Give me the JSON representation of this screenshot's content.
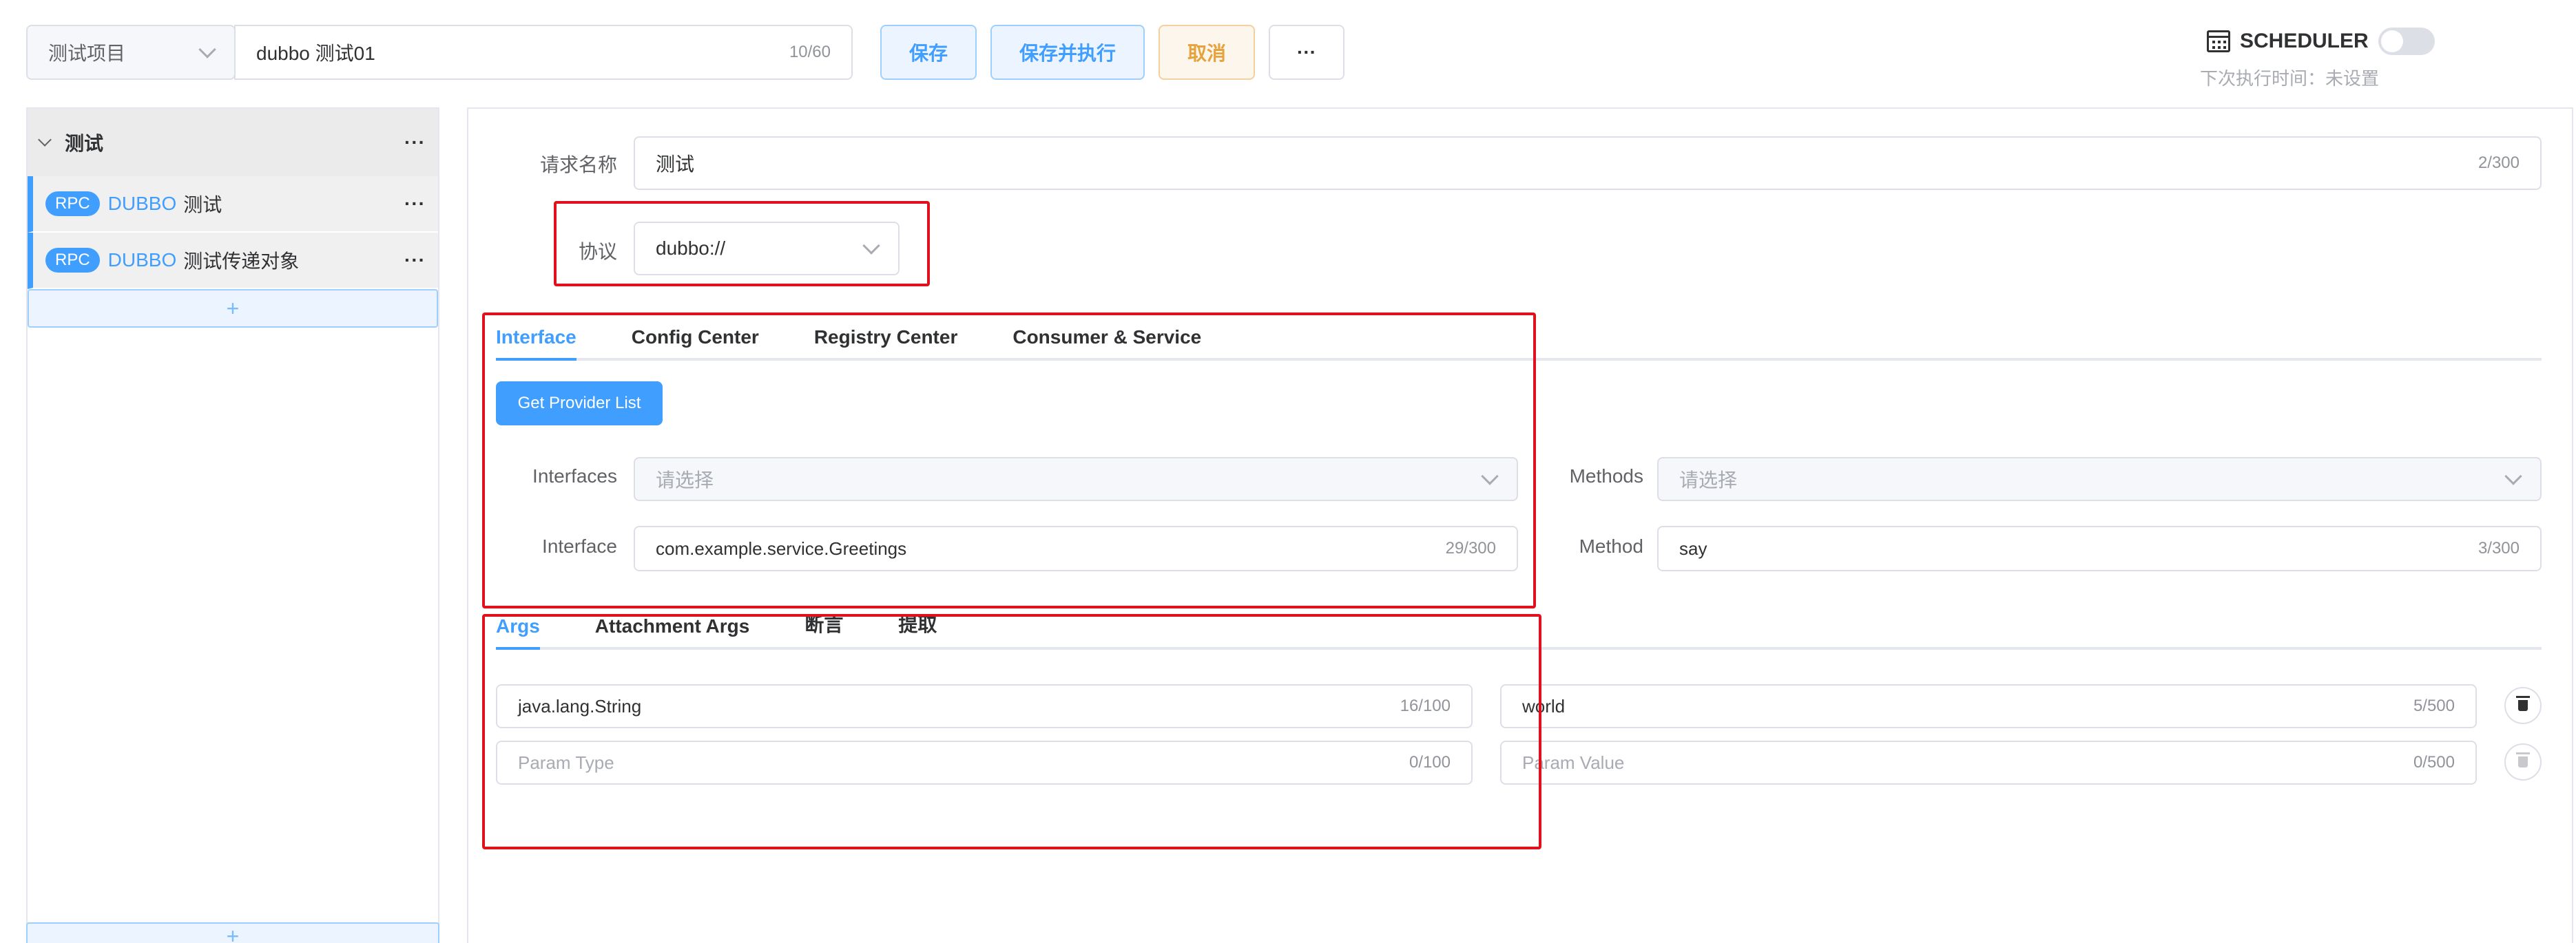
{
  "topbar": {
    "project_select": "测试项目",
    "name_input": "dubbo 测试01",
    "name_counter": "10/60",
    "save_label": "保存",
    "save_run_label": "保存并执行",
    "cancel_label": "取消",
    "more_label": "···",
    "scheduler_label": "SCHEDULER",
    "next_run_text": "下次执行时间：未设置"
  },
  "sidebar": {
    "group_label": "测试",
    "group_more": "···",
    "items": [
      {
        "tag": "RPC",
        "protocol": "DUBBO",
        "name": "测试",
        "more": "···"
      },
      {
        "tag": "RPC",
        "protocol": "DUBBO",
        "name": "测试传递对象",
        "more": "···"
      }
    ],
    "add_label": "+"
  },
  "request": {
    "name_label": "请求名称",
    "name_value": "测试",
    "name_counter": "2/300",
    "protocol_label": "协议",
    "protocol_value": "dubbo://"
  },
  "config_tabs": [
    "Interface",
    "Config Center",
    "Registry Center",
    "Consumer & Service"
  ],
  "interface": {
    "get_provider_label": "Get Provider List",
    "interfaces_label": "Interfaces",
    "interfaces_placeholder": "请选择",
    "methods_label": "Methods",
    "methods_placeholder": "请选择",
    "interface_label": "Interface",
    "interface_value": "com.example.service.Greetings",
    "interface_counter": "29/300",
    "method_label": "Method",
    "method_value": "say",
    "method_counter": "3/300"
  },
  "args_tabs": [
    "Args",
    "Attachment Args",
    "断言",
    "提取"
  ],
  "args": {
    "rows": [
      {
        "type": "java.lang.String",
        "type_counter": "16/100",
        "value": "world",
        "value_counter": "5/500"
      }
    ],
    "empty_row": {
      "type_placeholder": "Param Type",
      "type_counter": "0/100",
      "value_placeholder": "Param Value",
      "value_counter": "0/500"
    }
  },
  "colors": {
    "accent": "#409eff",
    "warning": "#e6a23c",
    "highlight_box": "#e0101c"
  }
}
